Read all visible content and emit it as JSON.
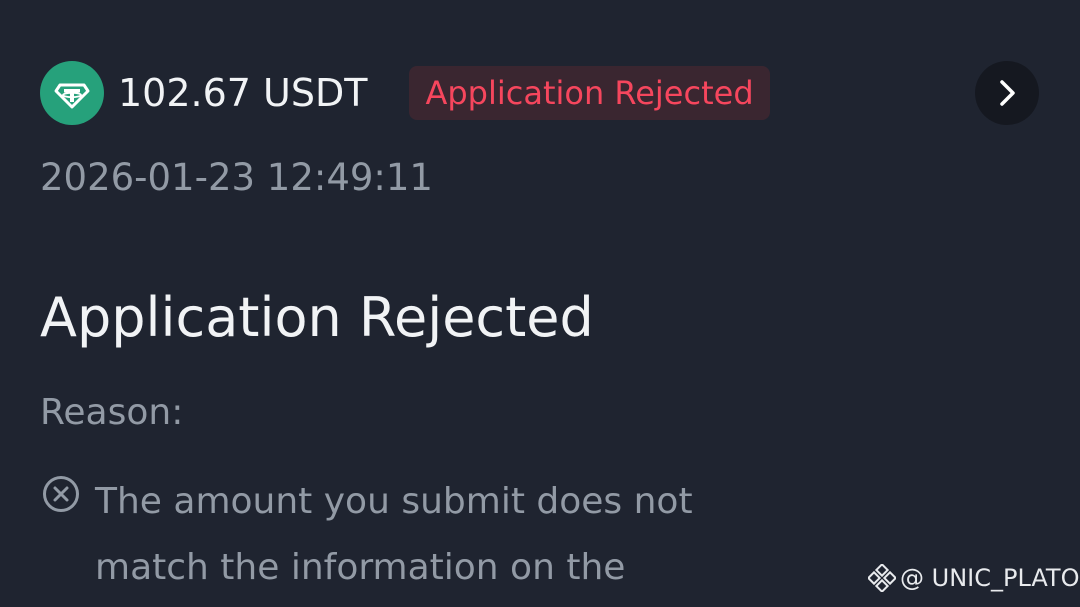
{
  "transaction": {
    "amount": "102.67 USDT",
    "status": "Application Rejected",
    "timestamp": "2026-01-23 12:49:11",
    "coin_icon": "tether-icon"
  },
  "details": {
    "title": "Application Rejected",
    "reason_label": "Reason:",
    "reason_text": "The amount you submit does not match the information on the"
  },
  "watermark": {
    "handle": "@ UNIC_PLATO"
  },
  "colors": {
    "background": "#1f2430",
    "rejected": "#f6465d",
    "tether": "#26a17b",
    "muted_text": "#929aa5"
  }
}
